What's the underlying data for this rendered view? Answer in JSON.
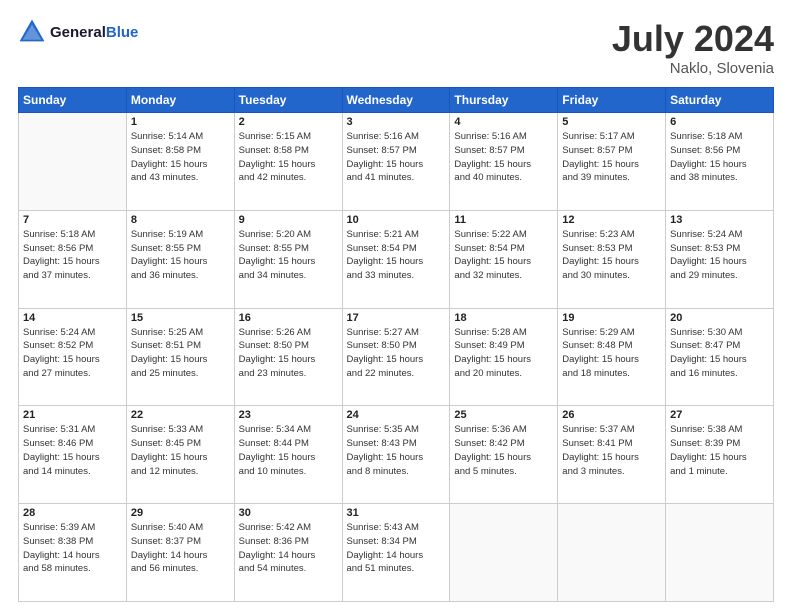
{
  "header": {
    "logo_line1": "General",
    "logo_line2": "Blue",
    "title": "July 2024",
    "subtitle": "Naklo, Slovenia"
  },
  "weekdays": [
    "Sunday",
    "Monday",
    "Tuesday",
    "Wednesday",
    "Thursday",
    "Friday",
    "Saturday"
  ],
  "weeks": [
    [
      {
        "day": "",
        "info": ""
      },
      {
        "day": "1",
        "info": "Sunrise: 5:14 AM\nSunset: 8:58 PM\nDaylight: 15 hours\nand 43 minutes."
      },
      {
        "day": "2",
        "info": "Sunrise: 5:15 AM\nSunset: 8:58 PM\nDaylight: 15 hours\nand 42 minutes."
      },
      {
        "day": "3",
        "info": "Sunrise: 5:16 AM\nSunset: 8:57 PM\nDaylight: 15 hours\nand 41 minutes."
      },
      {
        "day": "4",
        "info": "Sunrise: 5:16 AM\nSunset: 8:57 PM\nDaylight: 15 hours\nand 40 minutes."
      },
      {
        "day": "5",
        "info": "Sunrise: 5:17 AM\nSunset: 8:57 PM\nDaylight: 15 hours\nand 39 minutes."
      },
      {
        "day": "6",
        "info": "Sunrise: 5:18 AM\nSunset: 8:56 PM\nDaylight: 15 hours\nand 38 minutes."
      }
    ],
    [
      {
        "day": "7",
        "info": "Sunrise: 5:18 AM\nSunset: 8:56 PM\nDaylight: 15 hours\nand 37 minutes."
      },
      {
        "day": "8",
        "info": "Sunrise: 5:19 AM\nSunset: 8:55 PM\nDaylight: 15 hours\nand 36 minutes."
      },
      {
        "day": "9",
        "info": "Sunrise: 5:20 AM\nSunset: 8:55 PM\nDaylight: 15 hours\nand 34 minutes."
      },
      {
        "day": "10",
        "info": "Sunrise: 5:21 AM\nSunset: 8:54 PM\nDaylight: 15 hours\nand 33 minutes."
      },
      {
        "day": "11",
        "info": "Sunrise: 5:22 AM\nSunset: 8:54 PM\nDaylight: 15 hours\nand 32 minutes."
      },
      {
        "day": "12",
        "info": "Sunrise: 5:23 AM\nSunset: 8:53 PM\nDaylight: 15 hours\nand 30 minutes."
      },
      {
        "day": "13",
        "info": "Sunrise: 5:24 AM\nSunset: 8:53 PM\nDaylight: 15 hours\nand 29 minutes."
      }
    ],
    [
      {
        "day": "14",
        "info": "Sunrise: 5:24 AM\nSunset: 8:52 PM\nDaylight: 15 hours\nand 27 minutes."
      },
      {
        "day": "15",
        "info": "Sunrise: 5:25 AM\nSunset: 8:51 PM\nDaylight: 15 hours\nand 25 minutes."
      },
      {
        "day": "16",
        "info": "Sunrise: 5:26 AM\nSunset: 8:50 PM\nDaylight: 15 hours\nand 23 minutes."
      },
      {
        "day": "17",
        "info": "Sunrise: 5:27 AM\nSunset: 8:50 PM\nDaylight: 15 hours\nand 22 minutes."
      },
      {
        "day": "18",
        "info": "Sunrise: 5:28 AM\nSunset: 8:49 PM\nDaylight: 15 hours\nand 20 minutes."
      },
      {
        "day": "19",
        "info": "Sunrise: 5:29 AM\nSunset: 8:48 PM\nDaylight: 15 hours\nand 18 minutes."
      },
      {
        "day": "20",
        "info": "Sunrise: 5:30 AM\nSunset: 8:47 PM\nDaylight: 15 hours\nand 16 minutes."
      }
    ],
    [
      {
        "day": "21",
        "info": "Sunrise: 5:31 AM\nSunset: 8:46 PM\nDaylight: 15 hours\nand 14 minutes."
      },
      {
        "day": "22",
        "info": "Sunrise: 5:33 AM\nSunset: 8:45 PM\nDaylight: 15 hours\nand 12 minutes."
      },
      {
        "day": "23",
        "info": "Sunrise: 5:34 AM\nSunset: 8:44 PM\nDaylight: 15 hours\nand 10 minutes."
      },
      {
        "day": "24",
        "info": "Sunrise: 5:35 AM\nSunset: 8:43 PM\nDaylight: 15 hours\nand 8 minutes."
      },
      {
        "day": "25",
        "info": "Sunrise: 5:36 AM\nSunset: 8:42 PM\nDaylight: 15 hours\nand 5 minutes."
      },
      {
        "day": "26",
        "info": "Sunrise: 5:37 AM\nSunset: 8:41 PM\nDaylight: 15 hours\nand 3 minutes."
      },
      {
        "day": "27",
        "info": "Sunrise: 5:38 AM\nSunset: 8:39 PM\nDaylight: 15 hours\nand 1 minute."
      }
    ],
    [
      {
        "day": "28",
        "info": "Sunrise: 5:39 AM\nSunset: 8:38 PM\nDaylight: 14 hours\nand 58 minutes."
      },
      {
        "day": "29",
        "info": "Sunrise: 5:40 AM\nSunset: 8:37 PM\nDaylight: 14 hours\nand 56 minutes."
      },
      {
        "day": "30",
        "info": "Sunrise: 5:42 AM\nSunset: 8:36 PM\nDaylight: 14 hours\nand 54 minutes."
      },
      {
        "day": "31",
        "info": "Sunrise: 5:43 AM\nSunset: 8:34 PM\nDaylight: 14 hours\nand 51 minutes."
      },
      {
        "day": "",
        "info": ""
      },
      {
        "day": "",
        "info": ""
      },
      {
        "day": "",
        "info": ""
      }
    ]
  ]
}
